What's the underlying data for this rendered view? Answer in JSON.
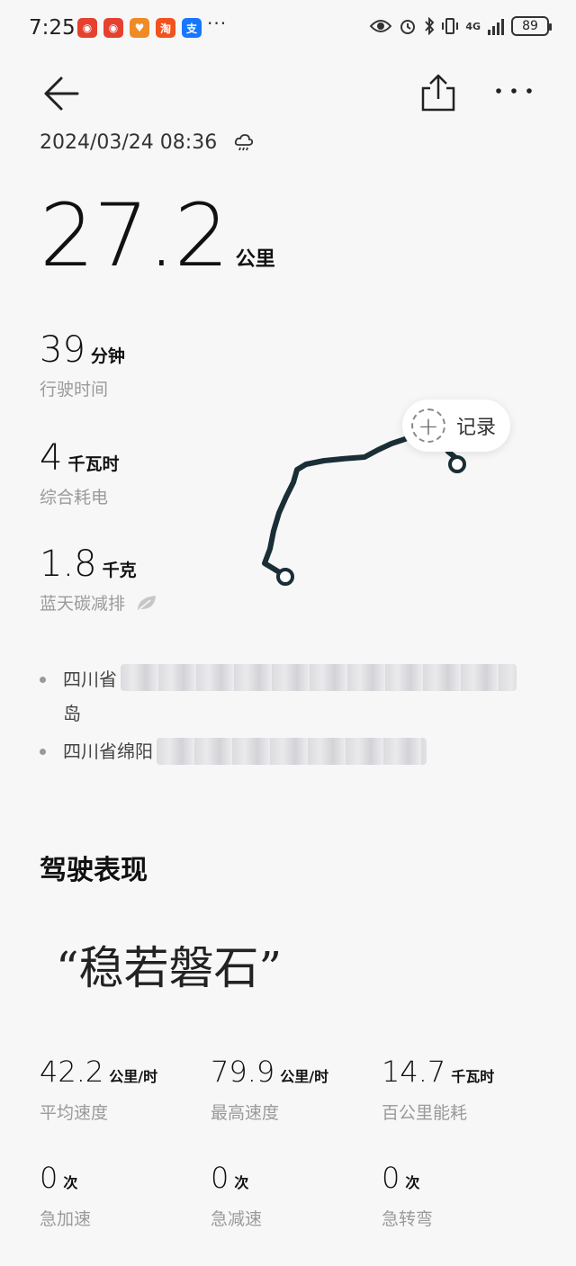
{
  "status_bar": {
    "time": "7:25",
    "notification_more": "···",
    "network": "4G",
    "battery": "89"
  },
  "trip": {
    "datetime": "2024/03/24 08:36",
    "weather_icon": "rain-cloud-icon",
    "distance_value": "27.2",
    "distance_unit": "公里"
  },
  "stats": [
    {
      "value": "39",
      "unit": "分钟",
      "label": "行驶时间"
    },
    {
      "value": "4",
      "unit": "千瓦时",
      "label": "综合耗电"
    },
    {
      "value": "1.8",
      "unit": "千克",
      "label": "蓝天碳减排"
    }
  ],
  "record_button": {
    "label": "记录"
  },
  "locations": [
    {
      "visible_text": "四川省",
      "continuation": "岛"
    },
    {
      "visible_text": "四川省绵阳",
      "continuation": ""
    }
  ],
  "driving": {
    "section_title": "驾驶表现",
    "rating": "“稳若磐石”"
  },
  "metrics": [
    {
      "value": "42.2",
      "unit": "公里/时",
      "label": "平均速度"
    },
    {
      "value": "79.9",
      "unit": "公里/时",
      "label": "最高速度"
    },
    {
      "value": "14.7",
      "unit": "千瓦时",
      "label": "百公里能耗"
    },
    {
      "value": "0",
      "unit": "次",
      "label": "急加速"
    },
    {
      "value": "0",
      "unit": "次",
      "label": "急减速"
    },
    {
      "value": "0",
      "unit": "次",
      "label": "急转弯"
    }
  ],
  "colors": {
    "background": "#f7f7f8",
    "route": "#1a2e35",
    "muted_text": "#9a9a9a"
  }
}
